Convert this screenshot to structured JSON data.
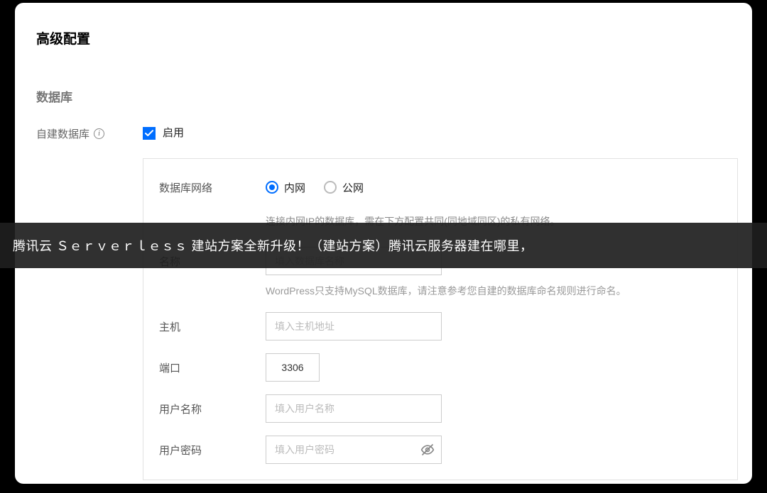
{
  "title": "高级配置",
  "section": {
    "database": "数据库"
  },
  "selfdb": {
    "label": "自建数据库",
    "enable_label": "启用",
    "checked": true
  },
  "fields": {
    "network": {
      "label": "数据库网络",
      "options": {
        "intranet": "内网",
        "public": "公网"
      },
      "hint": "连接内网IP的数据库，需在下方配置共同(同地域同区)的私有网络。"
    },
    "name": {
      "label": "名称",
      "placeholder": "填入数据库名称",
      "hint": "WordPress只支持MySQL数据库，请注意参考您自建的数据库命名规则进行命名。"
    },
    "host": {
      "label": "主机",
      "placeholder": "填入主机地址"
    },
    "port": {
      "label": "端口",
      "value": "3306"
    },
    "username": {
      "label": "用户名称",
      "placeholder": "填入用户名称"
    },
    "password": {
      "label": "用户密码",
      "placeholder": "填入用户密码"
    }
  },
  "banner": "腾讯云 Ｓｅｒｖｅｒｌｅｓｓ 建站方案全新升级！（建站方案）腾讯云服务器建在哪里，"
}
